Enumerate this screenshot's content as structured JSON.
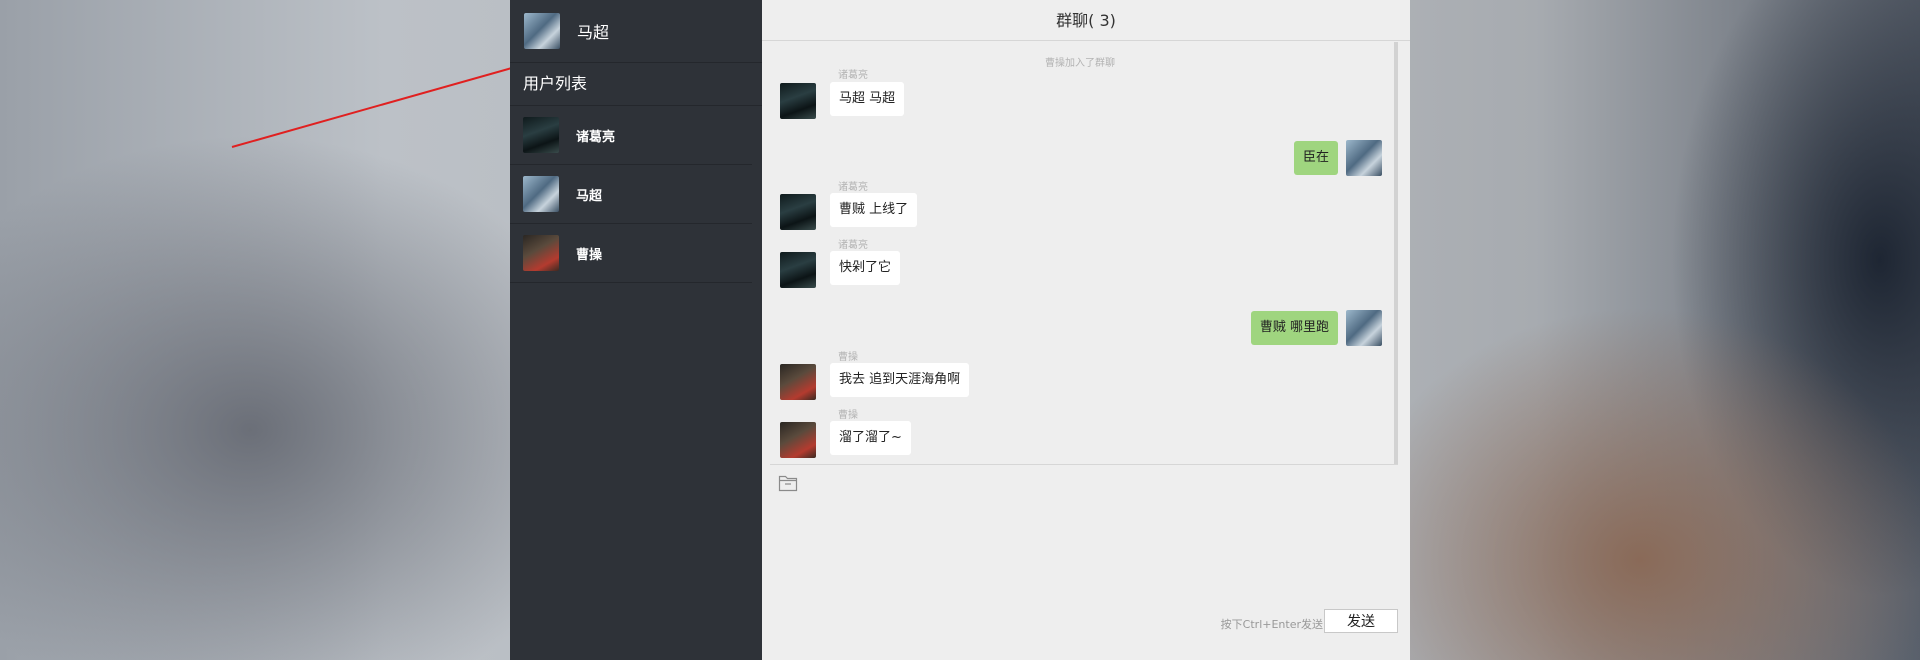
{
  "current_user": {
    "name": "马超",
    "avatar": "machao-avatar"
  },
  "sidebar": {
    "section_title": "用户列表",
    "users": [
      {
        "name": "诸葛亮",
        "avatar": "zhugeliang-avatar"
      },
      {
        "name": "马超",
        "avatar": "machao-avatar"
      },
      {
        "name": "曹操",
        "avatar": "caocao-avatar"
      }
    ]
  },
  "chat": {
    "title": "群聊( 3)",
    "system_message": "曹操加入了群聊",
    "messages": [
      {
        "sender": "诸葛亮",
        "text": "马超 马超",
        "side": "left"
      },
      {
        "sender": "",
        "text": "臣在",
        "side": "right"
      },
      {
        "sender": "诸葛亮",
        "text": "曹贼 上线了",
        "side": "left"
      },
      {
        "sender": "诸葛亮",
        "text": "快剁了它",
        "side": "left"
      },
      {
        "sender": "",
        "text": "曹贼 哪里跑",
        "side": "right"
      },
      {
        "sender": "曹操",
        "text": "我去 追到天涯海角啊",
        "side": "left"
      },
      {
        "sender": "曹操",
        "text": "溜了溜了~",
        "side": "left"
      }
    ]
  },
  "composer": {
    "hint": "按下Ctrl+Enter发送",
    "send_label": "发送",
    "file_icon": "folder-icon"
  },
  "colors": {
    "sidebar_bg": "#2e3238",
    "chat_bg": "#eeeeee",
    "own_bubble": "#9fd57f",
    "other_bubble": "#ffffff",
    "annotation_arrow": "#e02020"
  }
}
